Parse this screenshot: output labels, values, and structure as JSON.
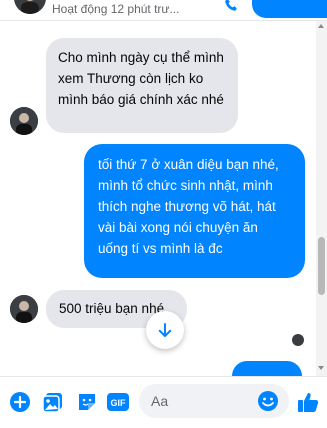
{
  "header": {
    "status_text": "Hoạt động 12 phút trư..."
  },
  "messages": [
    {
      "direction": "incoming",
      "text": "Cho mình ngày cụ thể mình xem Thương còn lịch ko mình báo giá chính xác nhé"
    },
    {
      "direction": "outgoing",
      "text": "tối thứ 7 ở xuân diệu bạn nhé, mình tổ chức sinh nhật, mình thích nghe thương võ hát, hát vài bài xong nói chuyện ăn uống tí vs mình là đc"
    },
    {
      "direction": "incoming",
      "text": "500 triệu bạn nhé"
    }
  ],
  "composer": {
    "placeholder": "Aa",
    "gif_label": "GIF"
  },
  "icons": {
    "add": "plus-circle-icon",
    "image": "image-icon",
    "sticker": "sticker-icon",
    "gif": "gif-icon",
    "emoji": "smiley-icon",
    "like": "thumbs-up-icon",
    "scroll_down": "arrow-down-icon",
    "phone": "phone-icon"
  },
  "colors": {
    "accent": "#0084ff",
    "incoming_bubble": "#e4e6eb",
    "outgoing_bubble": "#0084ff"
  }
}
